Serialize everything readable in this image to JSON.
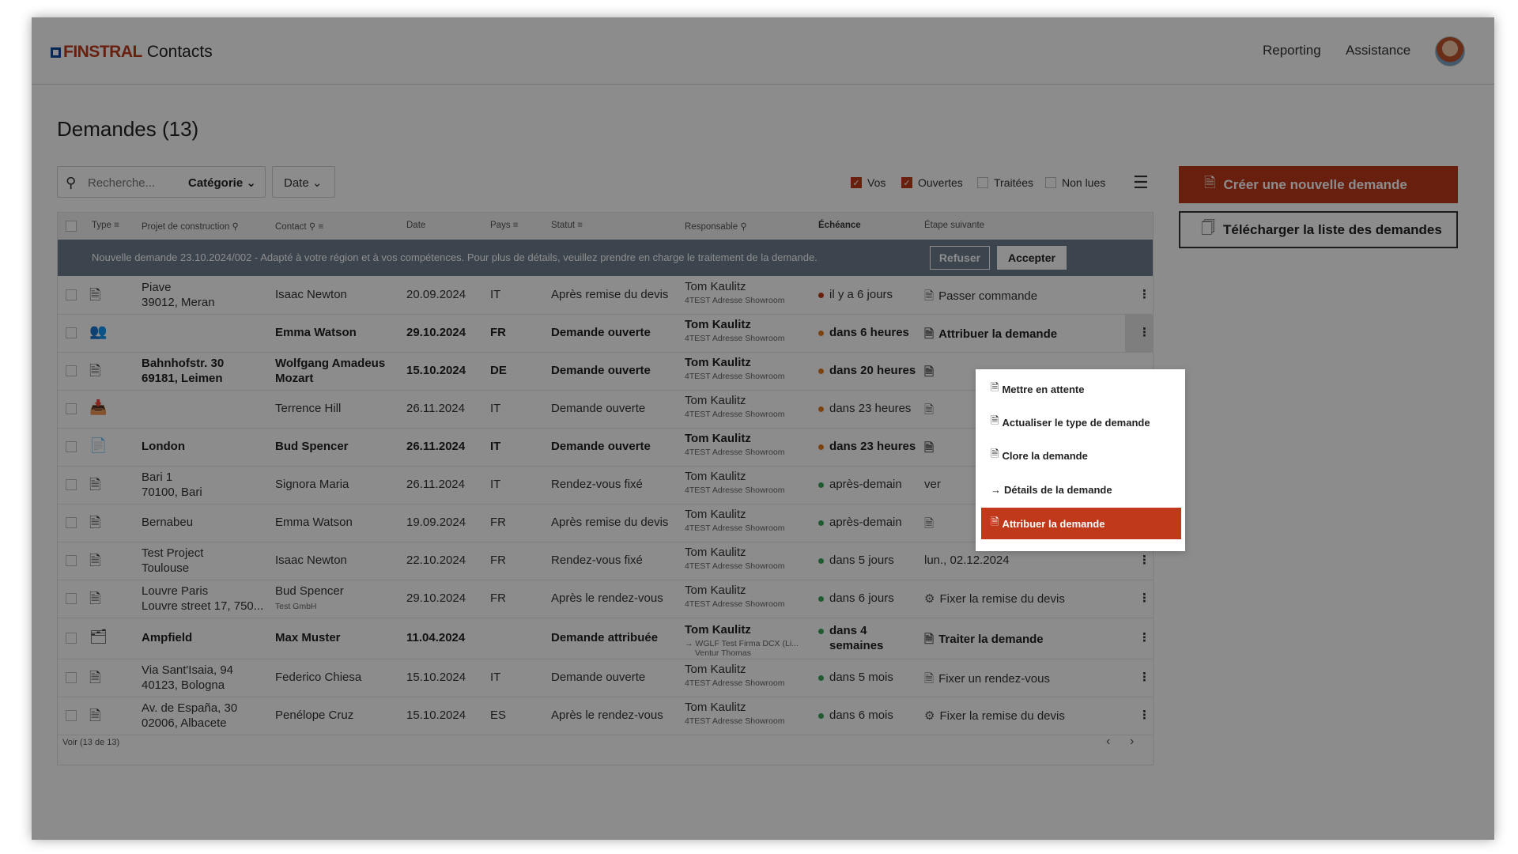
{
  "header": {
    "brand": "FINSTRAL",
    "app_name": "Contacts",
    "nav": [
      "Reporting",
      "Assistance"
    ]
  },
  "page": {
    "title": "Demandes (13)"
  },
  "toolbar": {
    "search_placeholder": "Recherche...",
    "category_label": "Catégorie ⌄",
    "date_label": "Date ⌄",
    "filters": [
      {
        "label": "Vos",
        "checked": true
      },
      {
        "label": "Ouvertes",
        "checked": true
      },
      {
        "label": "Traitées",
        "checked": false
      },
      {
        "label": "Non lues",
        "checked": false
      }
    ]
  },
  "actions": {
    "create": "Créer une nouvelle demande",
    "download": "Télécharger la liste des demandes"
  },
  "table": {
    "columns": [
      "Type",
      "Projet de construction",
      "Contact",
      "Date",
      "Pays",
      "Statut",
      "Responsable",
      "Échéance",
      "Étape suivante"
    ],
    "notice": {
      "text": "Nouvelle demande 23.10.2024/002 - Adapté à votre région et à vos compétences. Pour plus de détails, veuillez prendre en charge le traitement de la demande.",
      "refuse": "Refuser",
      "accept": "Accepter"
    },
    "rows": [
      {
        "icon": "document-icon",
        "project1": "Piave",
        "project2": "39012, Meran",
        "contact": "Isaac Newton",
        "contact_sub": "",
        "date": "20.09.2024",
        "country": "IT",
        "status": "Après remise du devis",
        "resp": "Tom Kaulitz",
        "resp_sub": "4TEST Adresse Showroom",
        "resp_sub2": "",
        "due": "il y a 6 jours",
        "due_color": "#c0391b",
        "due2": "",
        "step": "Passer commande",
        "bold": false
      },
      {
        "icon": "group-icon",
        "project1": "",
        "project2": "",
        "contact": "Emma Watson",
        "contact_sub": "",
        "date": "29.10.2024",
        "country": "FR",
        "status": "Demande ouverte",
        "resp": "Tom Kaulitz",
        "resp_sub": "4TEST Adresse Showroom",
        "resp_sub2": "",
        "due": "dans 6 heures",
        "due_color": "#e07b1f",
        "due2": "",
        "step": "Attribuer la demande",
        "bold": true
      },
      {
        "icon": "document-icon",
        "project1": "Bahnhofstr. 30",
        "project2": "69181, Leimen",
        "contact": "Wolfgang Amadeus",
        "contact_sub": "Mozart",
        "date": "15.10.2024",
        "country": "DE",
        "status": "Demande ouverte",
        "resp": "Tom Kaulitz",
        "resp_sub": "4TEST Adresse Showroom",
        "resp_sub2": "",
        "due": "dans 20 heures",
        "due_color": "#e07b1f",
        "due2": "",
        "step": "",
        "bold": true
      },
      {
        "icon": "inbox-icon",
        "project1": "",
        "project2": "",
        "contact": "Terrence Hill",
        "contact_sub": "",
        "date": "26.11.2024",
        "country": "IT",
        "status": "Demande ouverte",
        "resp": "Tom Kaulitz",
        "resp_sub": "4TEST Adresse Showroom",
        "resp_sub2": "",
        "due": "dans 23 heures",
        "due_color": "#e07b1f",
        "due2": "",
        "step": "",
        "bold": false
      },
      {
        "icon": "file-icon",
        "project1": "London",
        "project2": "",
        "contact": "Bud Spencer",
        "contact_sub": "",
        "date": "26.11.2024",
        "country": "IT",
        "status": "Demande ouverte",
        "resp": "Tom Kaulitz",
        "resp_sub": "4TEST Adresse Showroom",
        "resp_sub2": "",
        "due": "dans 23 heures",
        "due_color": "#e07b1f",
        "due2": "",
        "step": "",
        "bold": true
      },
      {
        "icon": "document-icon",
        "project1": "Bari 1",
        "project2": "70100, Bari",
        "contact": "Signora Maria",
        "contact_sub": "",
        "date": "26.11.2024",
        "country": "IT",
        "status": "Rendez-vous fixé",
        "resp": "Tom Kaulitz",
        "resp_sub": "4TEST Adresse Showroom",
        "resp_sub2": "",
        "due": "après-demain",
        "due_color": "#3aa655",
        "due2": "",
        "step": "ver",
        "bold": false
      },
      {
        "icon": "document-icon",
        "project1": "Bernabeu",
        "project2": "",
        "contact": "Emma Watson",
        "contact_sub": "",
        "date": "19.09.2024",
        "country": "FR",
        "status": "Après remise du devis",
        "resp": "Tom Kaulitz",
        "resp_sub": "4TEST Adresse Showroom",
        "resp_sub2": "",
        "due": "après-demain",
        "due_color": "#3aa655",
        "due2": "",
        "step": "",
        "bold": false
      },
      {
        "icon": "document-icon",
        "project1": "Test Project",
        "project2": "Toulouse",
        "contact": "Isaac Newton",
        "contact_sub": "",
        "date": "22.10.2024",
        "country": "FR",
        "status": "Rendez-vous fixé",
        "resp": "Tom Kaulitz",
        "resp_sub": "4TEST Adresse Showroom",
        "resp_sub2": "",
        "due": "dans 5 jours",
        "due_color": "#3aa655",
        "due2": "",
        "step": "lun., 02.12.2024",
        "bold": false
      },
      {
        "icon": "document-icon",
        "project1": "Louvre Paris",
        "project2": "Louvre street 17, 750...",
        "contact": "Bud Spencer",
        "contact_sub": "Test GmbH",
        "date": "29.10.2024",
        "country": "FR",
        "status": "Après le rendez-vous",
        "resp": "Tom Kaulitz",
        "resp_sub": "4TEST Adresse Showroom",
        "resp_sub2": "",
        "due": "dans 6 jours",
        "due_color": "#3aa655",
        "due2": "",
        "step": "Fixer la remise du devis",
        "bold": false
      },
      {
        "icon": "stack-icon",
        "project1": "Ampfield",
        "project2": "",
        "contact": "Max Muster",
        "contact_sub": "",
        "date": "11.04.2024",
        "country": "",
        "status": "Demande attribuée",
        "resp": "Tom Kaulitz",
        "resp_sub": "→ WGLF Test Firma DCX (Li...",
        "resp_sub2": "Ventur Thomas",
        "due": "dans 4",
        "due_color": "#3aa655",
        "due2": "semaines",
        "step": "Traiter la demande",
        "bold": true
      },
      {
        "icon": "document-icon",
        "project1": "Via Sant'Isaia, 94",
        "project2": "40123, Bologna",
        "contact": "Federico Chiesa",
        "contact_sub": "",
        "date": "15.10.2024",
        "country": "IT",
        "status": "Demande ouverte",
        "resp": "Tom Kaulitz",
        "resp_sub": "4TEST Adresse Showroom",
        "resp_sub2": "",
        "due": "dans 5 mois",
        "due_color": "#3aa655",
        "due2": "",
        "step": "Fixer un rendez-vous",
        "bold": false
      },
      {
        "icon": "document-icon",
        "project1": "Av. de España, 30",
        "project2": "02006, Albacete",
        "contact": "Penélope Cruz",
        "contact_sub": "",
        "date": "15.10.2024",
        "country": "ES",
        "status": "Après le rendez-vous",
        "resp": "Tom Kaulitz",
        "resp_sub": "4TEST Adresse Showroom",
        "resp_sub2": "",
        "due": "dans 6 mois",
        "due_color": "#3aa655",
        "due2": "",
        "step": "Fixer la remise du devis",
        "bold": false
      }
    ],
    "footer": "Voir  (13 de 13)"
  },
  "context_menu": {
    "items": [
      {
        "label": "Mettre en attente",
        "icon": "document-icon"
      },
      {
        "label": "Actualiser le type de demande",
        "icon": "document-icon"
      },
      {
        "label": "Clore la demande",
        "icon": "document-icon"
      },
      {
        "label": "Détails de la demande",
        "icon": "arrow-right-icon"
      },
      {
        "label": "Attribuer la demande",
        "icon": "document-icon"
      }
    ]
  },
  "colors": {
    "accent": "#c0391b",
    "notice_bg": "#6d7e8f",
    "brand_blue": "#0a4b9a"
  }
}
